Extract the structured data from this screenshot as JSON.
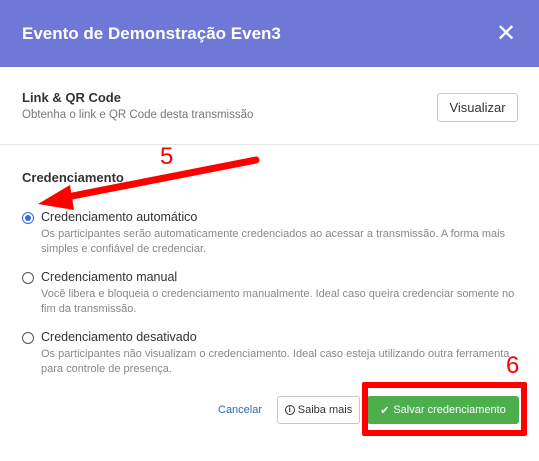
{
  "header": {
    "title": "Evento de Demonstração Even3",
    "close_icon": "close-icon"
  },
  "link_section": {
    "title": "Link & QR Code",
    "description": "Obtenha o link e QR Code desta transmissão",
    "button": "Visualizar"
  },
  "credenciamento": {
    "title": "Credenciamento",
    "selected": "auto",
    "options": [
      {
        "label": "Credenciamento automático",
        "description": "Os participantes serão automaticamente credenciados ao acessar a transmissão. A forma mais simples e confiável de credenciar.",
        "checked": true
      },
      {
        "label": "Credenciamento manual",
        "description": "Você libera e bloqueia o credenciamento manualmente. Ideal caso queira credenciar somente no fim da transmissão.",
        "checked": false
      },
      {
        "label": "Credenciamento desativado",
        "description": "Os participantes não visualizam o credenciamento. Ideal caso esteja utilizando outra ferramenta para controle de presença.",
        "checked": false
      }
    ]
  },
  "footer": {
    "cancel": "Cancelar",
    "saiba_mais": "Saiba mais",
    "salvar": "Salvar credenciamento"
  },
  "annotations": {
    "step_5": "5",
    "step_6": "6",
    "color": "#ff0000"
  },
  "colors": {
    "header_bg": "#6f78d6",
    "save_bg": "#4cae4c",
    "link": "#2a6fb0",
    "radio_checked": "#2f6de1"
  }
}
